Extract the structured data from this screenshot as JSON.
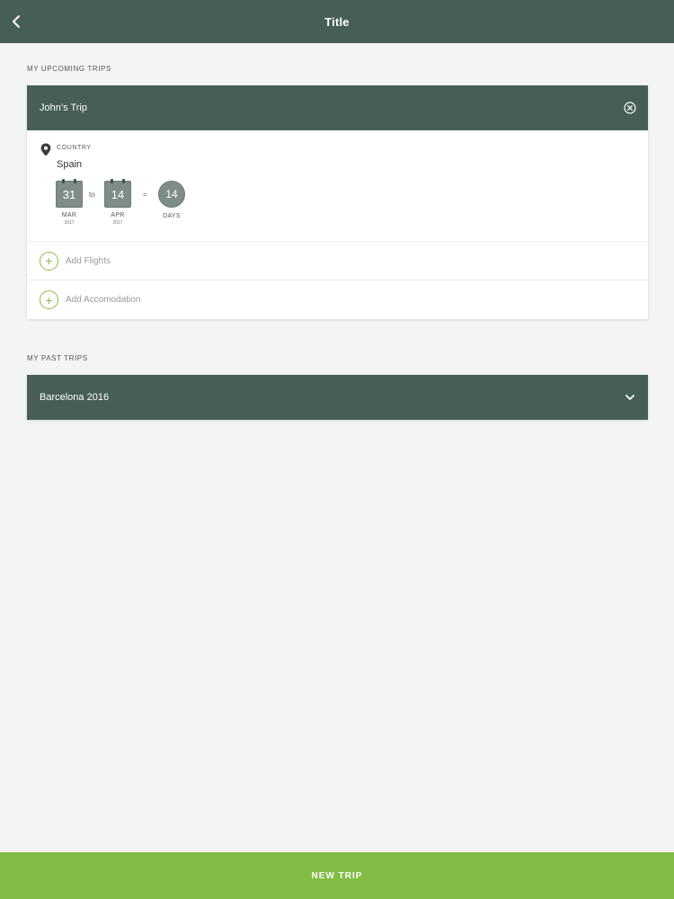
{
  "header": {
    "title": "Title",
    "back_icon": "chevron-left-icon"
  },
  "upcoming": {
    "section_label": "MY UPCOMING TRIPS",
    "trip": {
      "name": "John’s Trip",
      "close_icon": "close-circle-icon",
      "location_icon": "map-pin-icon",
      "country_label": "COUNTRY",
      "country": "Spain",
      "start": {
        "day": "31",
        "month": "MAR",
        "year": "2017"
      },
      "connector": "to",
      "end": {
        "day": "14",
        "month": "APR",
        "year": "2017"
      },
      "equals": "=",
      "duration": {
        "value": "14",
        "label": "DAYS"
      },
      "actions": [
        {
          "label": "Add Flights",
          "icon": "plus-circle-icon"
        },
        {
          "label": "Add Accomodation",
          "icon": "plus-circle-icon"
        }
      ]
    }
  },
  "past": {
    "section_label": "MY PAST TRIPS",
    "trips": [
      {
        "name": "Barcelona 2016",
        "icon": "chevron-down-icon"
      }
    ]
  },
  "footer": {
    "button_label": "NEW TRIP"
  },
  "colors": {
    "primary": "#465e56",
    "accent": "#82bc44",
    "background": "#f3f4f6",
    "badge": "#7f8d88"
  }
}
